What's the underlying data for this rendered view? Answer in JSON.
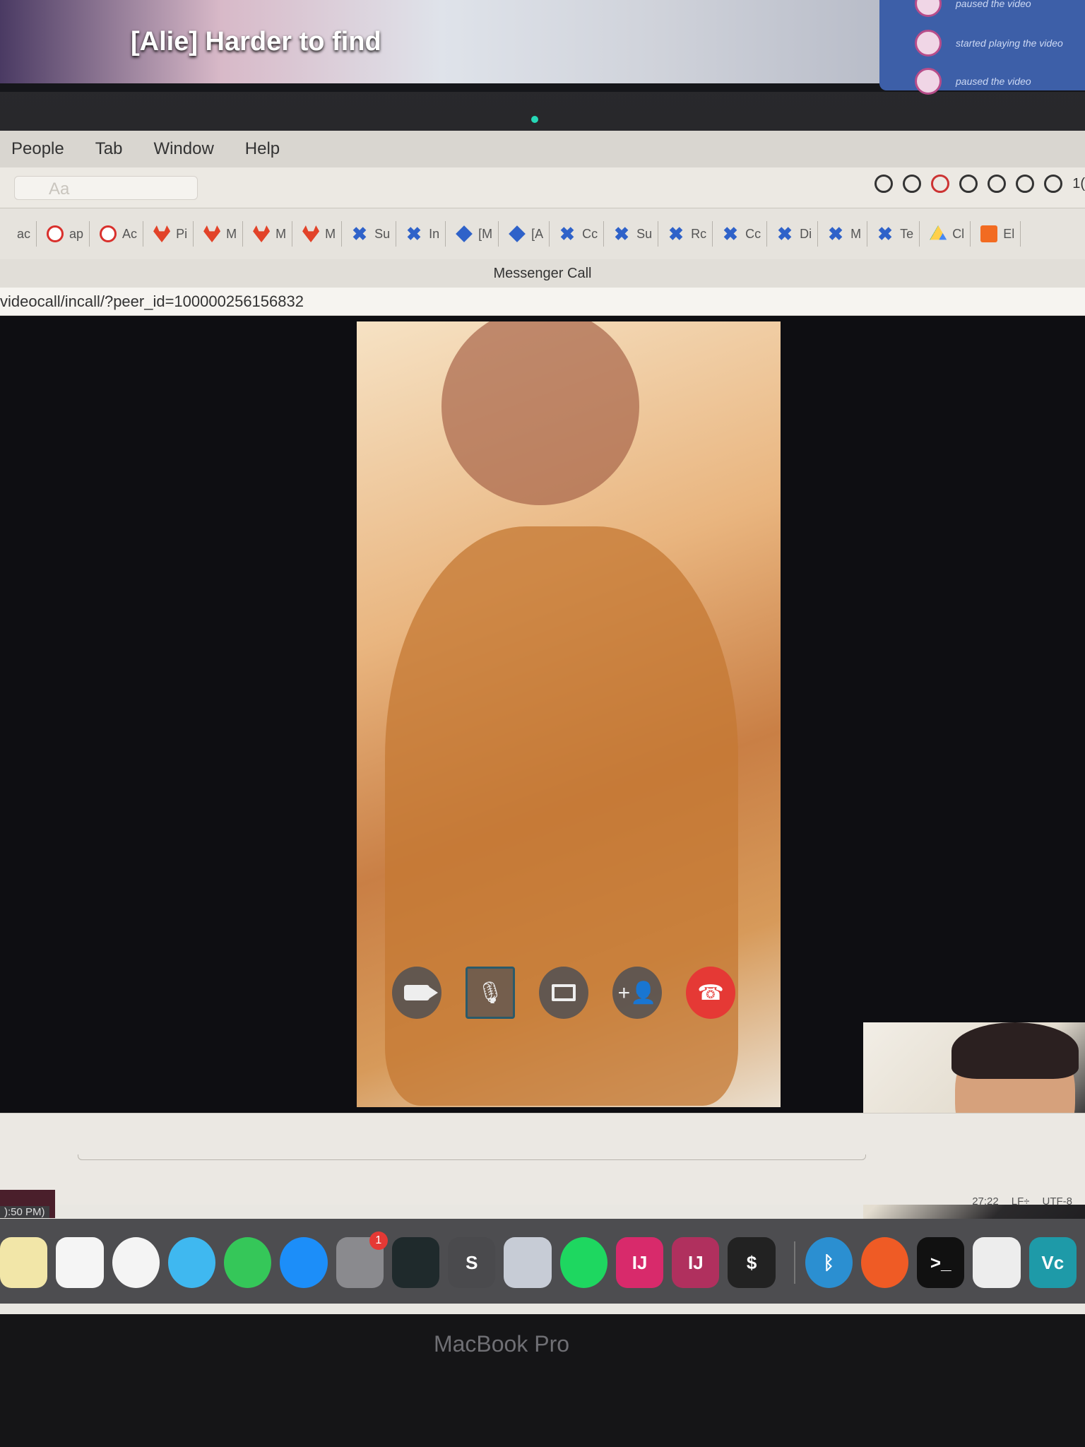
{
  "top_monitor": {
    "subtitle": "[Alie] Harder to find",
    "activity": [
      "paused the video",
      "started playing the video",
      "paused the video"
    ]
  },
  "menubar": {
    "items": [
      "People",
      "Tab",
      "Window",
      "Help"
    ]
  },
  "message_input": {
    "placeholder": "Aa"
  },
  "status_bar": {
    "clock_fragment": "1("
  },
  "bookmarks": [
    {
      "icon": "generic",
      "label": "ac"
    },
    {
      "icon": "check",
      "label": "ap"
    },
    {
      "icon": "check",
      "label": "Ac"
    },
    {
      "icon": "gitlab",
      "label": "Pi"
    },
    {
      "icon": "gitlab",
      "label": "M"
    },
    {
      "icon": "gitlab",
      "label": "M"
    },
    {
      "icon": "gitlab",
      "label": "M"
    },
    {
      "icon": "jira",
      "label": "Su"
    },
    {
      "icon": "jira",
      "label": "In"
    },
    {
      "icon": "diamond",
      "label": "[M"
    },
    {
      "icon": "diamond",
      "label": "[A"
    },
    {
      "icon": "jira",
      "label": "Cc"
    },
    {
      "icon": "jira",
      "label": "Su"
    },
    {
      "icon": "jira",
      "label": "Rc"
    },
    {
      "icon": "jira",
      "label": "Cc"
    },
    {
      "icon": "jira",
      "label": "Di"
    },
    {
      "icon": "jira",
      "label": "M"
    },
    {
      "icon": "jira",
      "label": "Te"
    },
    {
      "icon": "drive",
      "label": "Cl"
    },
    {
      "icon": "orange",
      "label": "El"
    }
  ],
  "window": {
    "title": "Messenger Call",
    "url": "videocall/incall/?peer_id=100000256156832"
  },
  "call_controls": [
    {
      "name": "video-toggle-button",
      "icon": "video-camera-icon",
      "glyph": ""
    },
    {
      "name": "mute-button",
      "icon": "microphone-icon",
      "glyph": "🎙"
    },
    {
      "name": "share-screen-button",
      "icon": "screen-share-icon",
      "glyph": ""
    },
    {
      "name": "add-person-button",
      "icon": "add-person-icon",
      "glyph": "+👤"
    },
    {
      "name": "end-call-button",
      "icon": "hang-up-icon",
      "glyph": "☎"
    }
  ],
  "editor_status": {
    "position": "27:22",
    "line_ending": "LF÷",
    "encoding": "UTF-8"
  },
  "dock": {
    "time_fragment": "):50 PM)",
    "apps": [
      {
        "name": "notes-icon",
        "color": "#f2e6a8",
        "label": ""
      },
      {
        "name": "reminders-icon",
        "color": "#f5f5f5",
        "label": ""
      },
      {
        "name": "photos-icon",
        "color": "#f4f4f4",
        "label": ""
      },
      {
        "name": "messages-icon",
        "color": "#3fb8f0",
        "label": ""
      },
      {
        "name": "facetime-icon",
        "color": "#35c759",
        "label": ""
      },
      {
        "name": "app-store-icon",
        "color": "#1c8ef9",
        "label": ""
      },
      {
        "name": "system-preferences-icon",
        "color": "#8a8a8e",
        "label": "",
        "badge": "1"
      },
      {
        "name": "activity-monitor-icon",
        "color": "#1f2a2c",
        "label": ""
      },
      {
        "name": "sublime-text-icon",
        "color": "#4a4a4d",
        "label": "S"
      },
      {
        "name": "preview-icon",
        "color": "#c7ccd6",
        "label": ""
      },
      {
        "name": "spotify-icon",
        "color": "#1ed760",
        "label": ""
      },
      {
        "name": "intellij-icon",
        "color": "#d82a6b",
        "label": "IJ"
      },
      {
        "name": "intellij-icon-2",
        "color": "#b0305e",
        "label": "IJ"
      },
      {
        "name": "terminal-icon",
        "color": "#222",
        "label": "$"
      },
      {
        "name": "bluetooth-icon",
        "color": "#2b8fd1",
        "label": "ᛒ"
      },
      {
        "name": "postman-icon",
        "color": "#ef5b25",
        "label": ""
      },
      {
        "name": "terminal-icon-2",
        "color": "#111",
        "label": ">_"
      },
      {
        "name": "textedit-icon",
        "color": "#ededed",
        "label": ""
      },
      {
        "name": "vscode-icon",
        "color": "#1e9aa8",
        "label": "Vc"
      }
    ]
  },
  "bezel": {
    "label": "MacBook Pro"
  }
}
